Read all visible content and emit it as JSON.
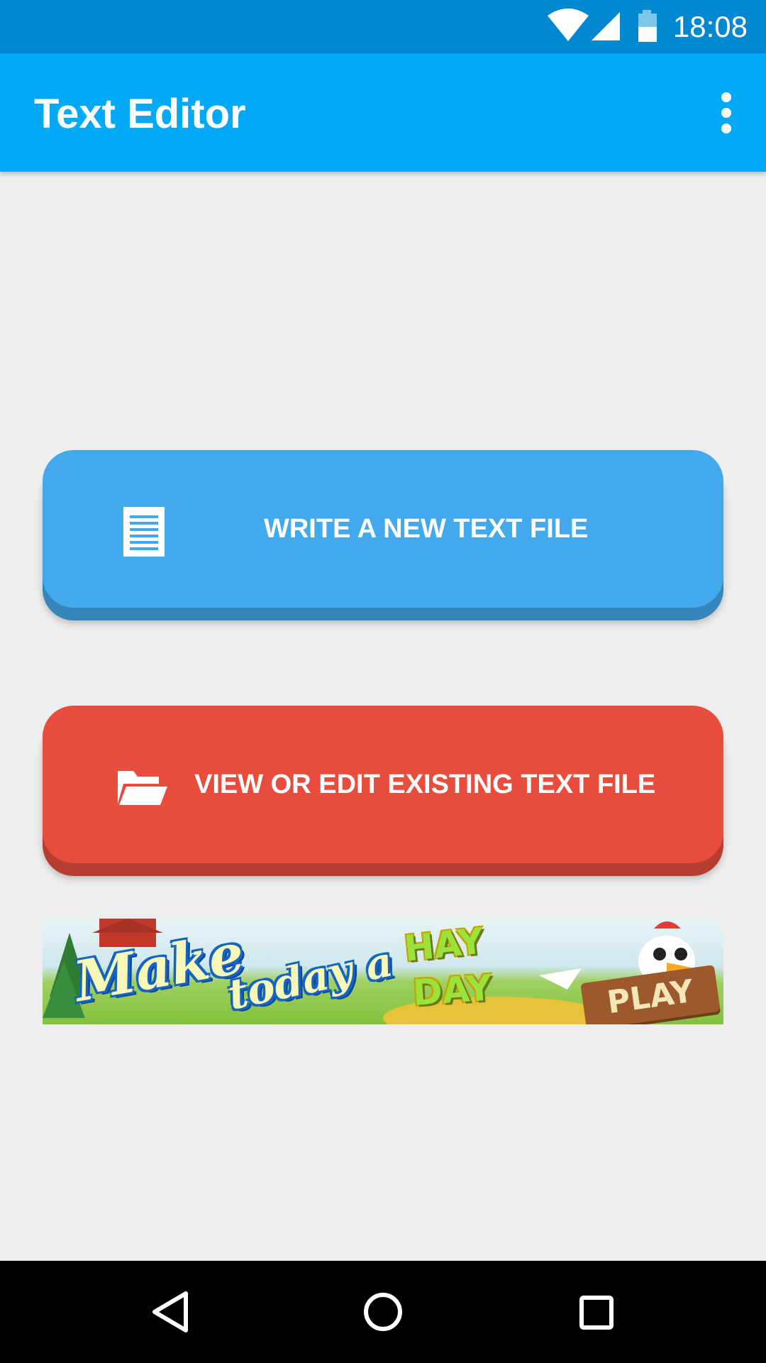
{
  "status_bar": {
    "time": "18:08",
    "icons": [
      "wifi-icon",
      "cell-signal-icon",
      "battery-icon"
    ],
    "color": "#0288d1"
  },
  "app_bar": {
    "title": "Text Editor",
    "overflow_icon": "more-vert-icon",
    "color": "#03a9f4"
  },
  "actions": {
    "write_new": {
      "label": "WRITE A NEW TEXT FILE",
      "icon": "document-icon",
      "color": "#42aaec"
    },
    "view_edit": {
      "label": "VIEW OR EDIT EXISTING TEXT FILE",
      "icon": "folder-open-icon",
      "color": "#e74c3c"
    }
  },
  "ad_banner": {
    "line1": "Make",
    "line2": "today a",
    "brand_line1": "HAY",
    "brand_line2": "DAY",
    "cta": "PLAY"
  },
  "nav_bar": {
    "buttons": [
      "back-icon",
      "home-icon",
      "recents-icon"
    ]
  }
}
